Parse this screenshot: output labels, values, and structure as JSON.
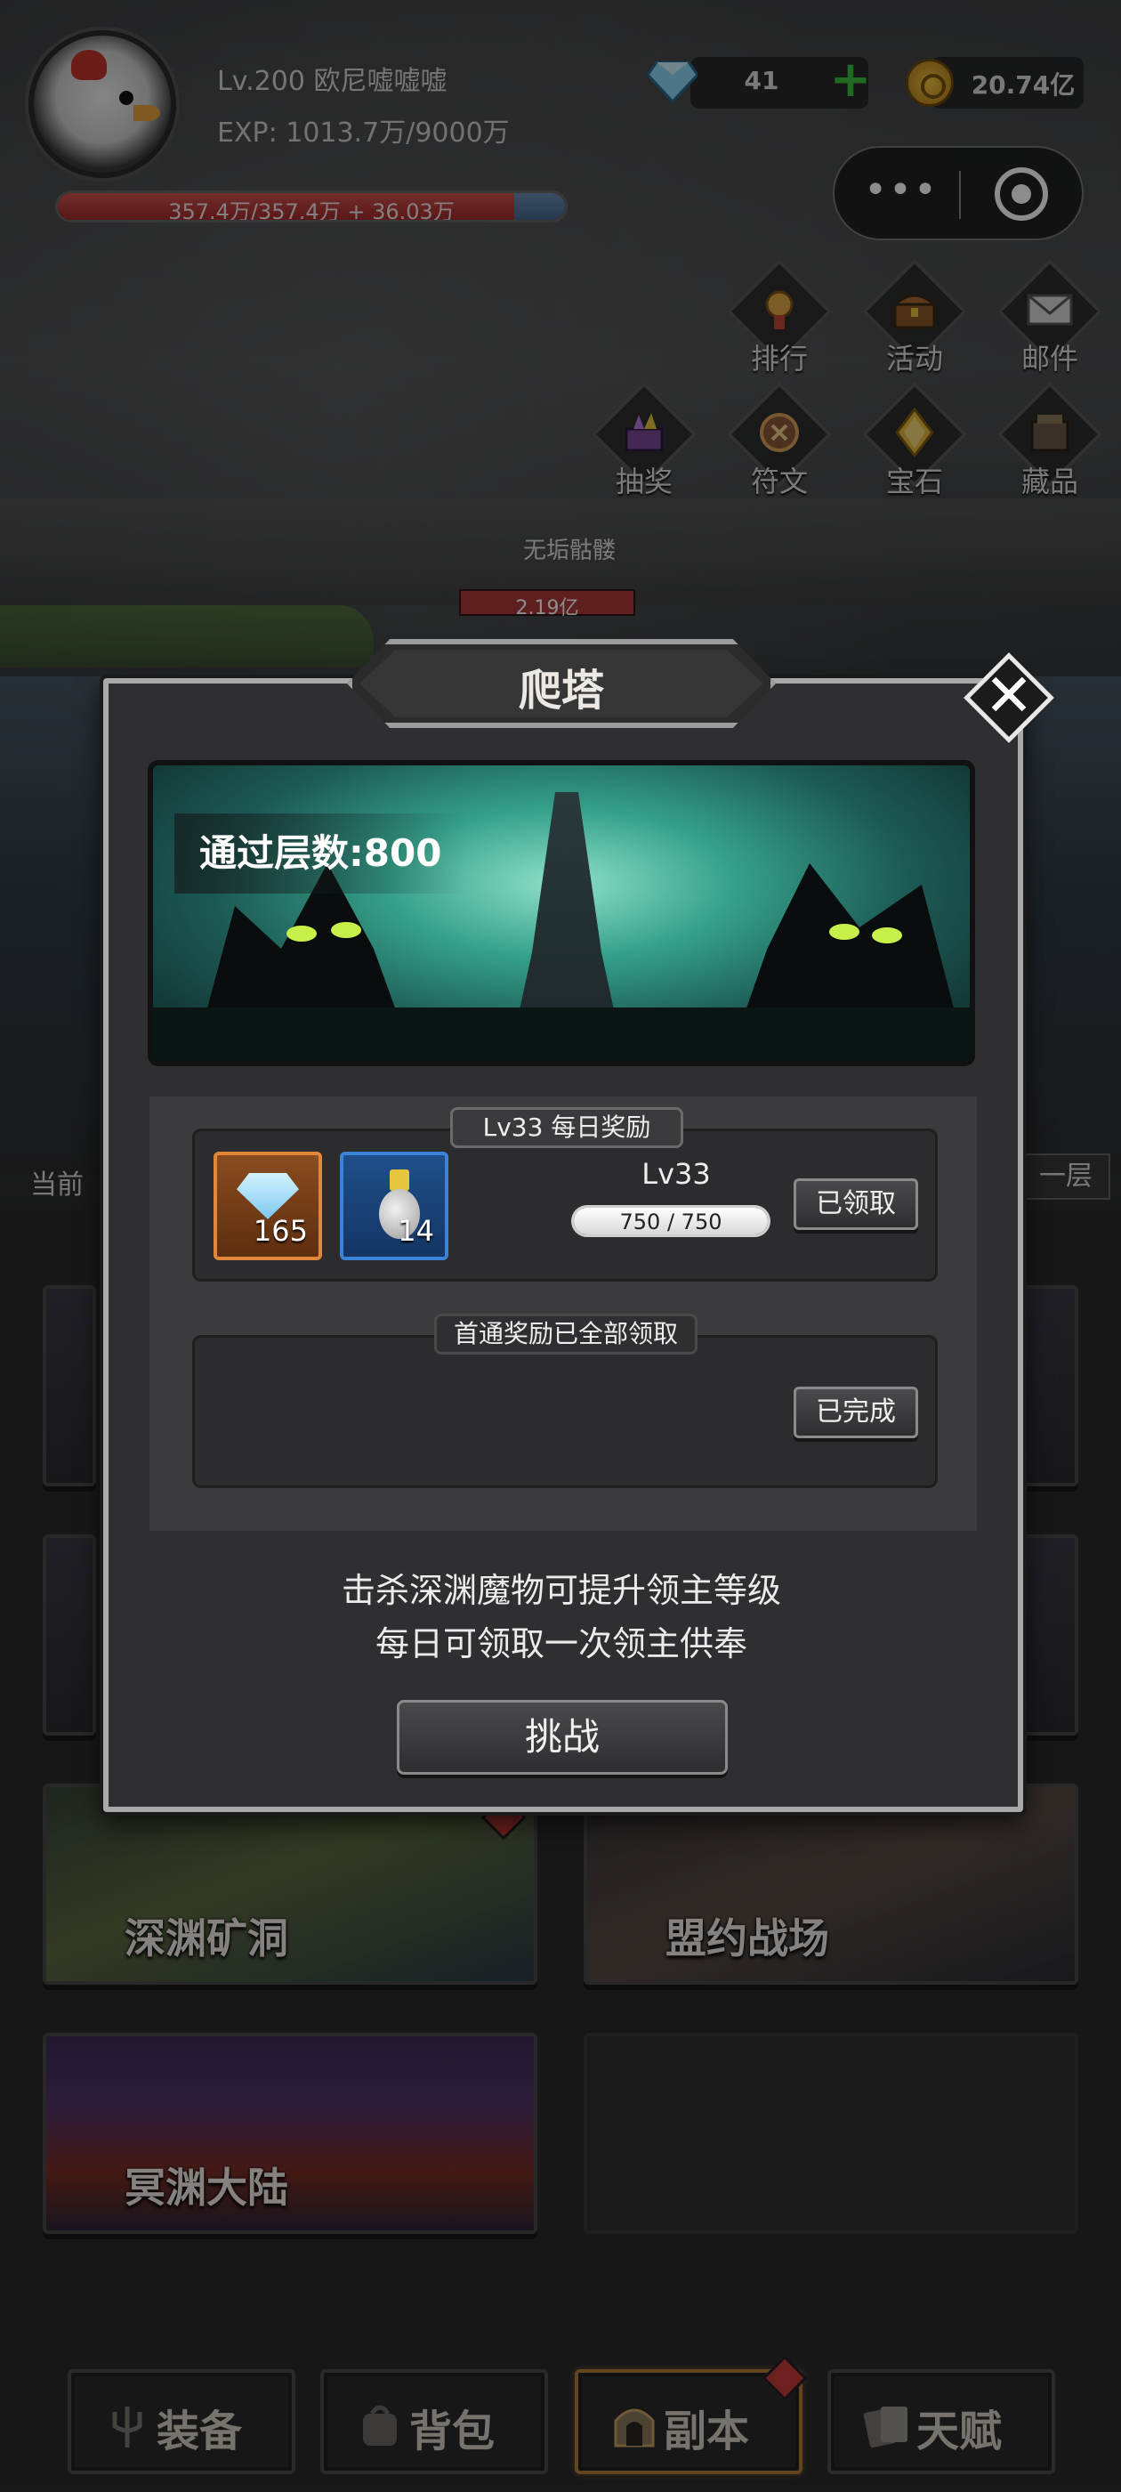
{
  "player": {
    "level_name": "Lv.200 欧尼嘘嘘嘘",
    "exp": "EXP: 1013.7万/9000万",
    "hp": "357.4万/357.4万 + 36.03万",
    "hp_fraction": 0.9
  },
  "currency": {
    "gems": "41",
    "gold": "20.74亿"
  },
  "top_menu": [
    {
      "label": "排行",
      "icon": "medal-icon"
    },
    {
      "label": "活动",
      "icon": "treasure-chest-icon"
    },
    {
      "label": "邮件",
      "icon": "mail-icon"
    },
    {
      "label": "抽奖",
      "icon": "lottery-chest-icon"
    },
    {
      "label": "符文",
      "icon": "rune-icon"
    },
    {
      "label": "宝石",
      "icon": "gem-icon"
    },
    {
      "label": "藏品",
      "icon": "collection-icon"
    }
  ],
  "enemy": {
    "name": "无垢骷髅",
    "hp": "2.19亿"
  },
  "side": {
    "left": "当前",
    "right": "一层"
  },
  "cards": {
    "abyss_mine": "深渊矿洞",
    "alliance_battlefield": "盟约战场",
    "underworld_continent": "冥渊大陆"
  },
  "bottom_nav": [
    {
      "label": "装备",
      "icon": "trident-icon"
    },
    {
      "label": "背包",
      "icon": "backpack-icon"
    },
    {
      "label": "副本",
      "icon": "dungeon-gate-icon"
    },
    {
      "label": "天赋",
      "icon": "talent-cards-icon"
    }
  ],
  "popup": {
    "title": "爬塔",
    "floors_passed": "通过层数:800",
    "daily_tag": "Lv33 每日奖励",
    "daily_items": [
      {
        "icon": "diamond-icon",
        "qty": "165"
      },
      {
        "icon": "potion-icon",
        "qty": "14"
      }
    ],
    "daily_level": "Lv33",
    "daily_progress": "750 / 750",
    "daily_progress_fraction": 1.0,
    "daily_button": "已领取",
    "first_tag": "首通奖励已全部领取",
    "first_button": "已完成",
    "desc_line1": "击杀深渊魔物可提升领主等级",
    "desc_line2": "每日可领取一次领主供奉",
    "challenge_button": "挑战"
  },
  "colors": {
    "hp_red": "#c0403f",
    "gem_plus_green": "#3cc13c",
    "item_orange": "#e2863a",
    "item_blue": "#3b83d6",
    "active_nav_gold": "#b07f3a"
  }
}
